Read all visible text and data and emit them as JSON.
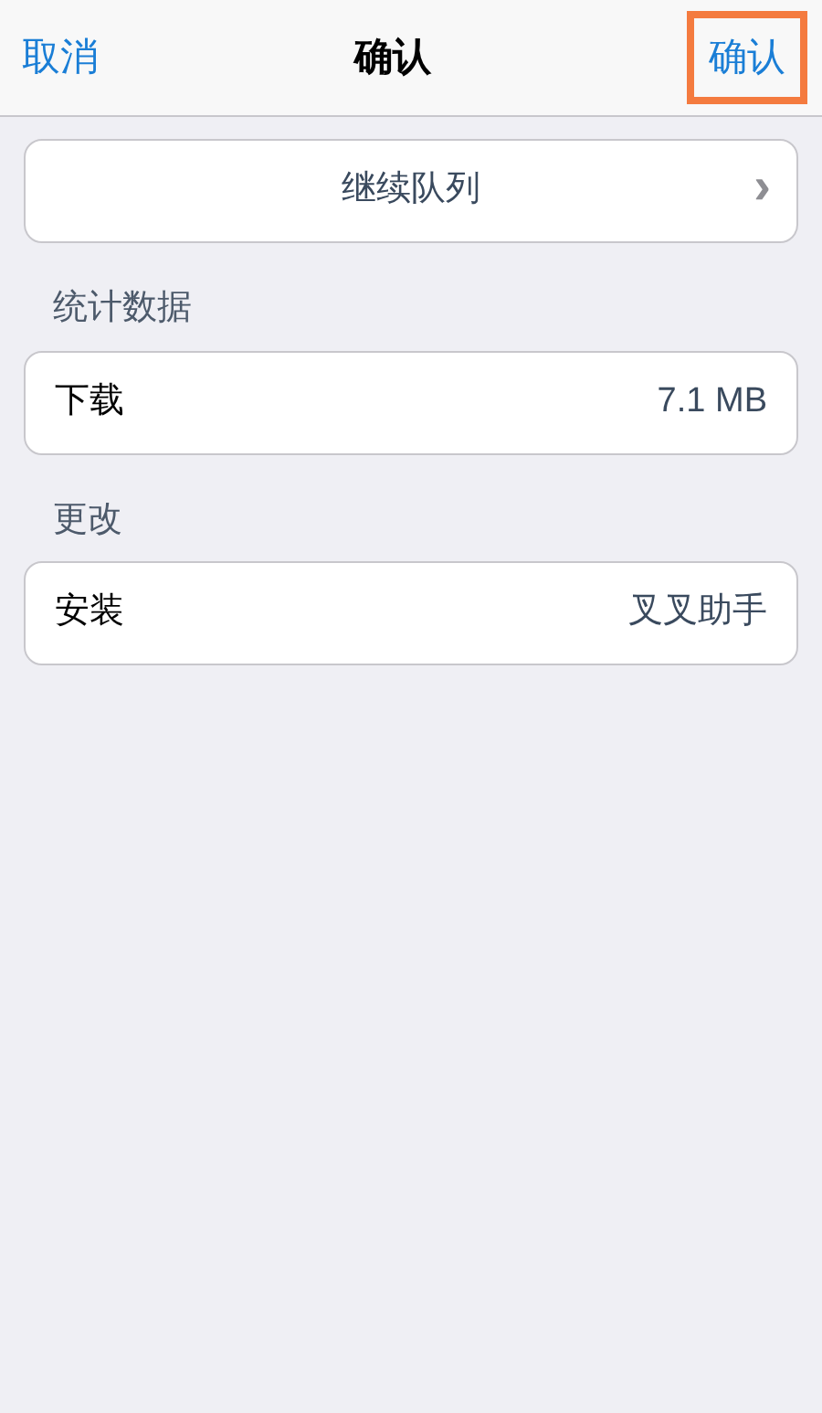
{
  "nav_bar": {
    "left_button": "取消",
    "title": "确认",
    "right_button": {
      "label": "确认",
      "highlighted": true
    }
  },
  "queue_button": {
    "label": "继续队列",
    "chevron": "›"
  },
  "sections": [
    {
      "header": "统计数据",
      "rows": [
        {
          "label": "下载",
          "value": "7.1 MB"
        }
      ]
    },
    {
      "header": "更改",
      "rows": [
        {
          "label": "安装",
          "value": "叉叉助手"
        }
      ]
    }
  ]
}
